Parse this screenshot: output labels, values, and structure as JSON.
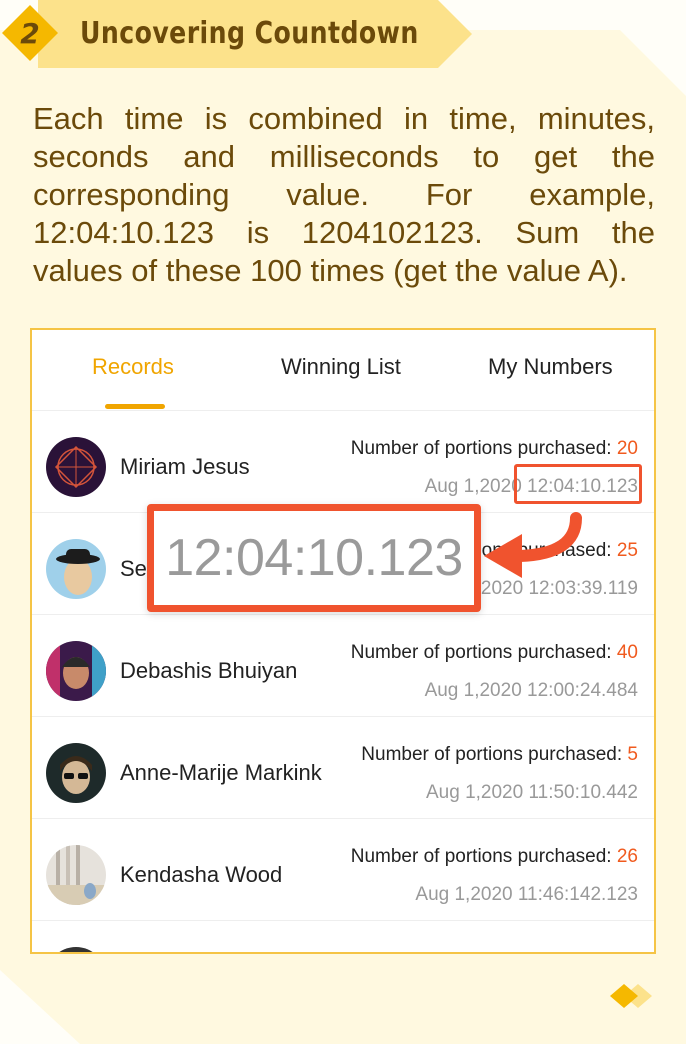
{
  "header": {
    "step_number": "2",
    "title": "Uncovering Countdown"
  },
  "instructions": "Each time is combined in time, minutes, seconds and milliseconds to get the corresponding value. For example, 12:04:10.123 is 1204102123. Sum the values of these 100 times (get the value A).",
  "tabs": [
    {
      "label": "Records",
      "active": true
    },
    {
      "label": "Winning List",
      "active": false
    },
    {
      "label": "My Numbers",
      "active": false
    }
  ],
  "records": [
    {
      "name": "Miriam Jesus",
      "portions_label": "Number of portions purchased: ",
      "portions": "20",
      "date": "Aug 1,2020",
      "time": "12:04:10.123"
    },
    {
      "name": "Se",
      "portions_label": "Number of portions purchased: ",
      "portions": "25",
      "date": "Aug 1,2020",
      "time": "12:03:39.119"
    },
    {
      "name": "Debashis Bhuiyan",
      "portions_label": "Number of portions purchased: ",
      "portions": "40",
      "date": "Aug 1,2020",
      "time": "12:00:24.484"
    },
    {
      "name": "Anne-Marije Markink",
      "portions_label": "Number of portions purchased: ",
      "portions": "5",
      "date": "Aug 1,2020",
      "time": "11:50:10.442"
    },
    {
      "name": "Kendasha Wood",
      "portions_label": "Number of portions purchased: ",
      "portions": "26",
      "date": "Aug 1,2020",
      "time": "11:46:142.123"
    }
  ],
  "zoom": {
    "text": "12:04:10.123"
  },
  "colors": {
    "accent": "#f0a500",
    "highlight": "#f0532e",
    "count": "#f05a1e",
    "heading": "#6b4a0a",
    "panel_border": "#f5c445"
  }
}
